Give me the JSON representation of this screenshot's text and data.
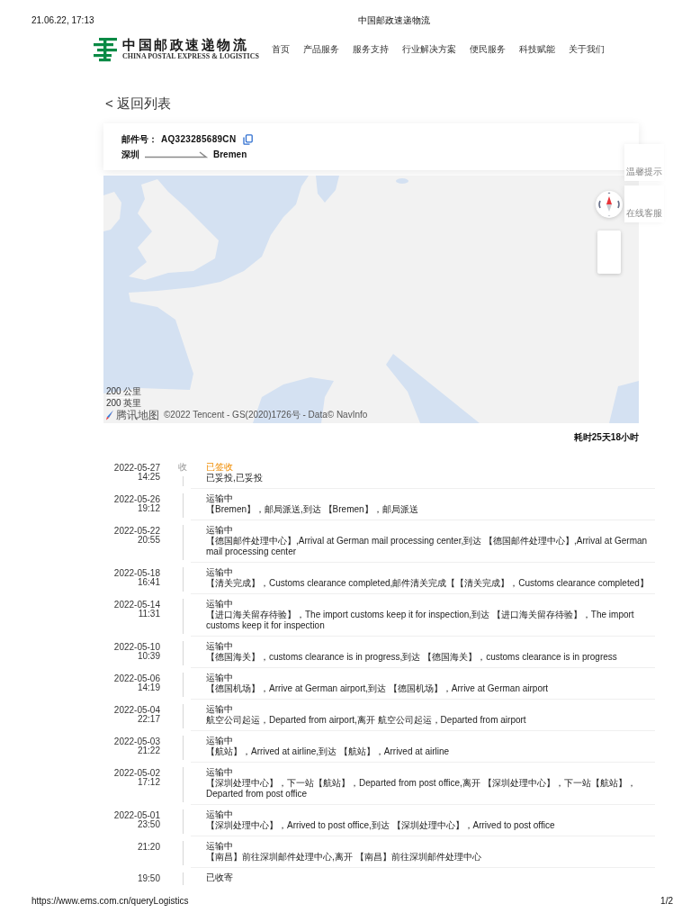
{
  "print_header": {
    "datetime": "21.06.22, 17:13",
    "title": "中国邮政速递物流"
  },
  "site_header": {
    "logo_text": "中国邮政速递物流",
    "logo_subtitle": "CHINA POSTAL EXPRESS & LOGISTICS",
    "nav": [
      {
        "label": "首页",
        "selected": false
      },
      {
        "label": "产品服务",
        "selected": false
      },
      {
        "label": "服务支持",
        "selected": false
      },
      {
        "label": "行业解决方案",
        "selected": false
      },
      {
        "label": "便民服务",
        "selected": false
      },
      {
        "label": "科技赋能",
        "selected": false
      },
      {
        "label": "关于我们",
        "selected": false
      }
    ]
  },
  "back_link": "< 返回列表",
  "shipment": {
    "number_label": "邮件号：",
    "number": "AQ323285689CN",
    "origin": "深圳",
    "destination": "Bremen"
  },
  "side_tabs": [
    {
      "label": "温馨提示"
    },
    {
      "label": "在线客服"
    }
  ],
  "map": {
    "scale": [
      "200 公里",
      "200 英里"
    ],
    "brand": "腾讯地图",
    "attribution": "©2022 Tencent - GS(2020)1726号 - Data© NavInfo"
  },
  "duration": "耗时25天18小时",
  "events": [
    {
      "date": "2022-05-27",
      "time": "14:25",
      "marker": "收",
      "status": "已签收",
      "current": true,
      "detail": "已妥投,已妥投"
    },
    {
      "date": "2022-05-26",
      "time": "19:12",
      "status": "运输中",
      "current": false,
      "detail": "【Bremen】，邮局派送,到达 【Bremen】，邮局派送"
    },
    {
      "date": "2022-05-22",
      "time": "20:55",
      "status": "运输中",
      "current": false,
      "detail": "【德国邮件处理中心】,Arrival at German mail processing center,到达 【德国邮件处理中心】,Arrival at German mail processing center"
    },
    {
      "date": "2022-05-18",
      "time": "16:41",
      "status": "运输中",
      "current": false,
      "detail": "【清关完成】，Customs clearance completed,邮件清关完成【【清关完成】，Customs clearance completed】"
    },
    {
      "date": "2022-05-14",
      "time": "11:31",
      "status": "运输中",
      "current": false,
      "detail": "【进口海关留存待验】，The import customs keep it for inspection,到达 【进口海关留存待验】，The import customs keep it for inspection"
    },
    {
      "date": "2022-05-10",
      "time": "10:39",
      "status": "运输中",
      "current": false,
      "detail": "【德国海关】，customs clearance is in progress,到达 【德国海关】，customs clearance is in progress"
    },
    {
      "date": "2022-05-06",
      "time": "14:19",
      "status": "运输中",
      "current": false,
      "detail": "【德国机场】，Arrive at German airport,到达 【德国机场】，Arrive at German airport"
    },
    {
      "date": "2022-05-04",
      "time": "22:17",
      "status": "运输中",
      "current": false,
      "detail": "航空公司起运，Departed from airport,离开 航空公司起运，Departed from airport"
    },
    {
      "date": "2022-05-03",
      "time": "21:22",
      "status": "运输中",
      "current": false,
      "detail": "【航站】，Arrived at airline,到达 【航站】，Arrived at airline"
    },
    {
      "date": "2022-05-02",
      "time": "17:12",
      "status": "运输中",
      "current": false,
      "detail": "【深圳处理中心】，下一站【航站】，Departed from post office,离开 【深圳处理中心】，下一站【航站】，Departed from post office"
    },
    {
      "date": "2022-05-01",
      "time": "23:50",
      "status": "运输中",
      "current": false,
      "detail": "【深圳处理中心】，Arrived to post office,到达 【深圳处理中心】，Arrived to post office"
    },
    {
      "time": "21:20",
      "status": "运输中",
      "current": false,
      "detail": "【南昌】前往深圳邮件处理中心,离开 【南昌】前往深圳邮件处理中心"
    },
    {
      "time": "19:50",
      "status": "已收寄",
      "current": false
    }
  ],
  "footer": {
    "url": "https://www.ems.com.cn/queryLogistics",
    "page": "1/2"
  }
}
